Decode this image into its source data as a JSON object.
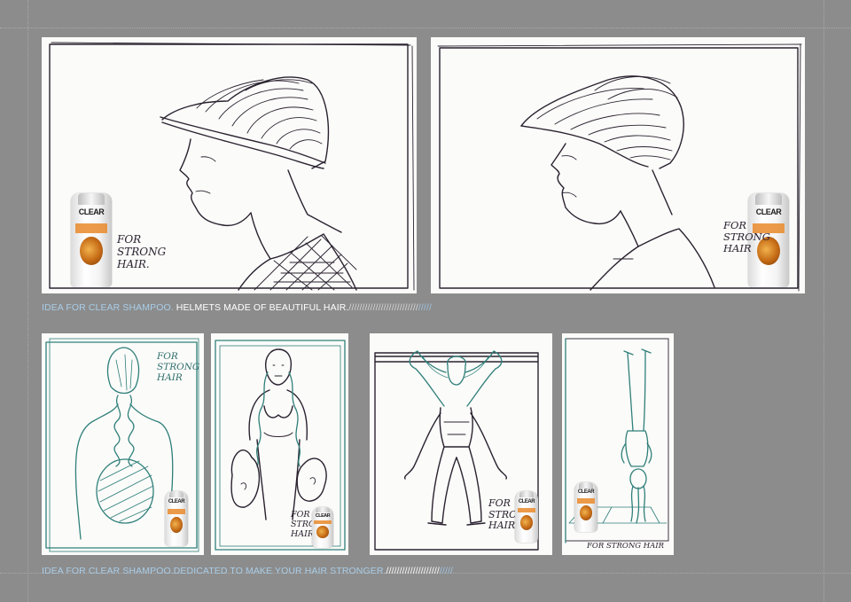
{
  "top_row": {
    "panel_1": {
      "tagline": "FOR\nSTRONG\nHAIR.",
      "bottle_brand": "CLEAR"
    },
    "panel_2": {
      "tagline": "FOR\nSTRONG\nHAIR",
      "bottle_brand": "CLEAR"
    },
    "caption": {
      "lead": "IDEA FOR CLEAR SHAMPOO.",
      "main": " HELMETS MADE OF BEAUTIFUL HAIR.",
      "slashes": "//////////////////////////",
      "tail": "/////"
    }
  },
  "bottom_row": {
    "panel_3": {
      "tagline": "FOR\nSTRONG\nHAIR",
      "bottle_brand": "CLEAR"
    },
    "panel_4": {
      "tagline": "FOR\nSTRONG\nHAIR",
      "bottle_brand": "CLEAR"
    },
    "panel_5": {
      "tagline": "FOR\nSTRONG\nHAIR",
      "bottle_brand": "CLEAR"
    },
    "panel_6": {
      "tagline": "FOR STRONG HAIR",
      "bottle_brand": "CLEAR"
    },
    "caption": {
      "lead": "IDEA FOR CLEAR SHAMPOO.DEDICATED TO MAKE YOUR HAIR STRONGER.",
      "slashes": "////////////////////",
      "tail": "/////"
    }
  },
  "colors": {
    "background": "#8c8c8c",
    "caption_blue": "#a9cde8",
    "ink": "#2a2230",
    "teal_ink": "#2f7f7a",
    "bottle_orange": "#e98a2a"
  }
}
